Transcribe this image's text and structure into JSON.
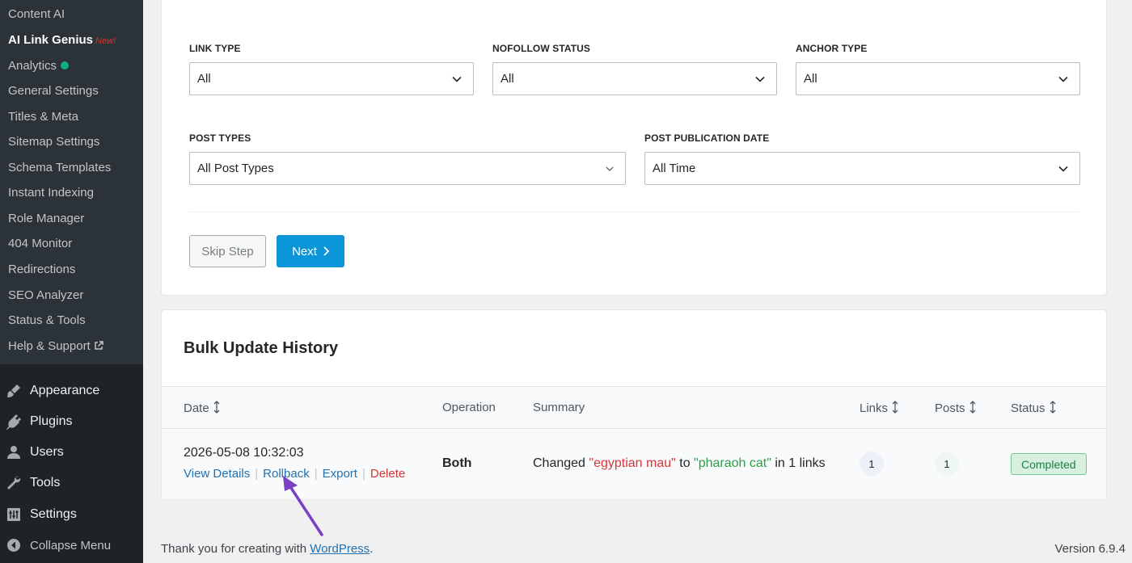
{
  "sidebar": {
    "submenu": [
      {
        "label": "Content AI"
      },
      {
        "label": "AI Link Genius",
        "badge": "New!"
      },
      {
        "label": "Analytics"
      },
      {
        "label": "General Settings"
      },
      {
        "label": "Titles & Meta"
      },
      {
        "label": "Sitemap Settings"
      },
      {
        "label": "Schema Templates"
      },
      {
        "label": "Instant Indexing"
      },
      {
        "label": "Role Manager"
      },
      {
        "label": "404 Monitor"
      },
      {
        "label": "Redirections"
      },
      {
        "label": "SEO Analyzer"
      },
      {
        "label": "Status & Tools"
      },
      {
        "label": "Help & Support"
      }
    ],
    "menu": [
      {
        "label": "Appearance",
        "icon": "paintbrush-icon"
      },
      {
        "label": "Plugins",
        "icon": "plugin-icon"
      },
      {
        "label": "Users",
        "icon": "users-icon"
      },
      {
        "label": "Tools",
        "icon": "wrench-icon"
      },
      {
        "label": "Settings",
        "icon": "settings-icon"
      },
      {
        "label": "Collapse Menu",
        "icon": "collapse-icon"
      }
    ]
  },
  "filters": {
    "link_type": {
      "label": "LINK TYPE",
      "value": "All"
    },
    "nofollow_status": {
      "label": "NOFOLLOW STATUS",
      "value": "All"
    },
    "anchor_type": {
      "label": "ANCHOR TYPE",
      "value": "All"
    },
    "post_types": {
      "label": "POST TYPES",
      "value": "All Post Types"
    },
    "post_publication_date": {
      "label": "POST PUBLICATION DATE",
      "value": "All Time"
    },
    "skip_label": "Skip Step",
    "next_label": "Next"
  },
  "history": {
    "title": "Bulk Update History",
    "columns": {
      "date": "Date",
      "operation": "Operation",
      "summary": "Summary",
      "links": "Links",
      "posts": "Posts",
      "status": "Status"
    },
    "rows": [
      {
        "date": "2026-05-08 10:32:03",
        "actions": {
          "view": "View Details",
          "rollback": "Rollback",
          "export": "Export",
          "delete": "Delete"
        },
        "operation": "Both",
        "summary": {
          "prefix": "Changed ",
          "from": "\"egyptian mau\"",
          "mid": " to ",
          "to": "\"pharaoh cat\"",
          "suffix": " in 1 links"
        },
        "links": "1",
        "posts": "1",
        "status": "Completed"
      }
    ]
  },
  "footer": {
    "thanks_prefix": "Thank you for creating with ",
    "wordpress_link": "WordPress",
    "thanks_suffix": ".",
    "version": "Version 6.9.4"
  },
  "colors": {
    "accent": "#0c95d8",
    "annotation_arrow": "#7b3fc4",
    "status_completed": "#1e7e44"
  }
}
